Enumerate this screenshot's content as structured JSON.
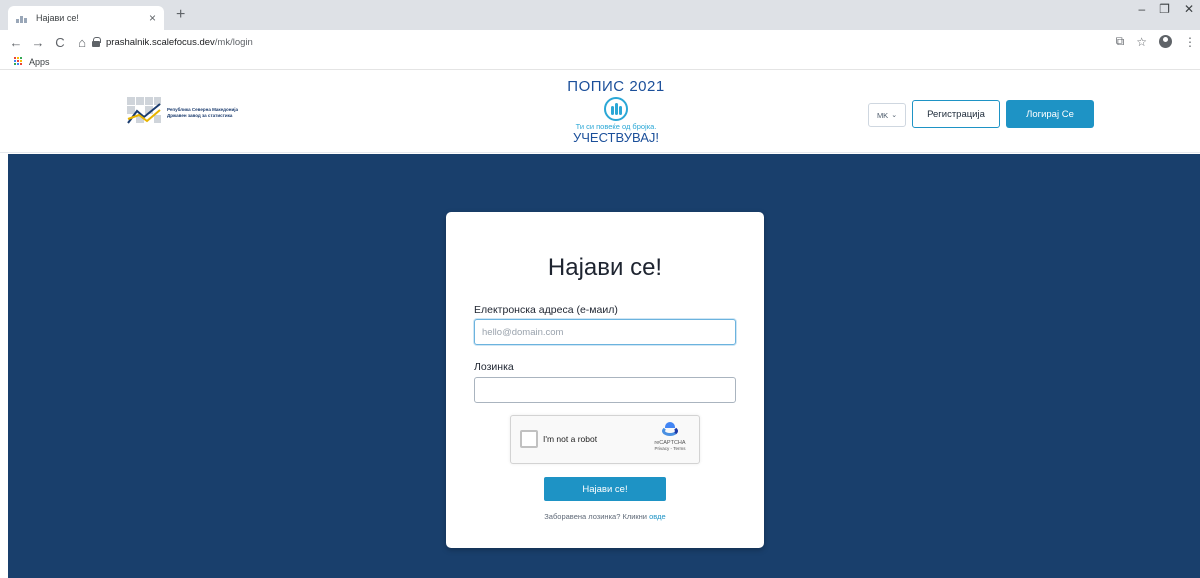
{
  "browser": {
    "tab_title": "Најави се!",
    "tab_close": "×",
    "new_tab": "+",
    "url_host": "prashalnik.scalefocus.dev",
    "url_path": "/mk/login",
    "bookmarks": [
      {
        "label": "Apps"
      }
    ],
    "window_controls": {
      "minimize": "–",
      "restore": "❐",
      "close": "✕"
    },
    "nav": {
      "back": "←",
      "forward": "→",
      "reload": "C",
      "home": "⌂"
    }
  },
  "header": {
    "org_lines": [
      "Република Северна Македонија",
      "Државен завод за статистика"
    ],
    "census": {
      "title": "ПОПИС",
      "year": "2021",
      "tagline": "Ти си повеќе од бројка.",
      "cta": "УЧЕСТВУВАЈ!"
    },
    "language": "MK",
    "register_label": "Регистрација",
    "login_label": "Логирај Се"
  },
  "login": {
    "title": "Најави се!",
    "email_label": "Електронска адреса (е-маил)",
    "email_placeholder": "hello@domain.com",
    "email_value": "",
    "password_label": "Лозинка",
    "password_value": "",
    "submit_label": "Најави се!",
    "forgot_text": "Заборавена лозинка? Кликни ",
    "forgot_link": "овде"
  },
  "recaptcha": {
    "label": "I'm not a robot",
    "brand": "reCAPTCHA",
    "links": "Privacy - Terms"
  },
  "colors": {
    "primary": "#1e93c5",
    "main_background": "#193f6c",
    "census_blue": "#1b4f9a",
    "census_cyan": "#2aa7d6"
  }
}
